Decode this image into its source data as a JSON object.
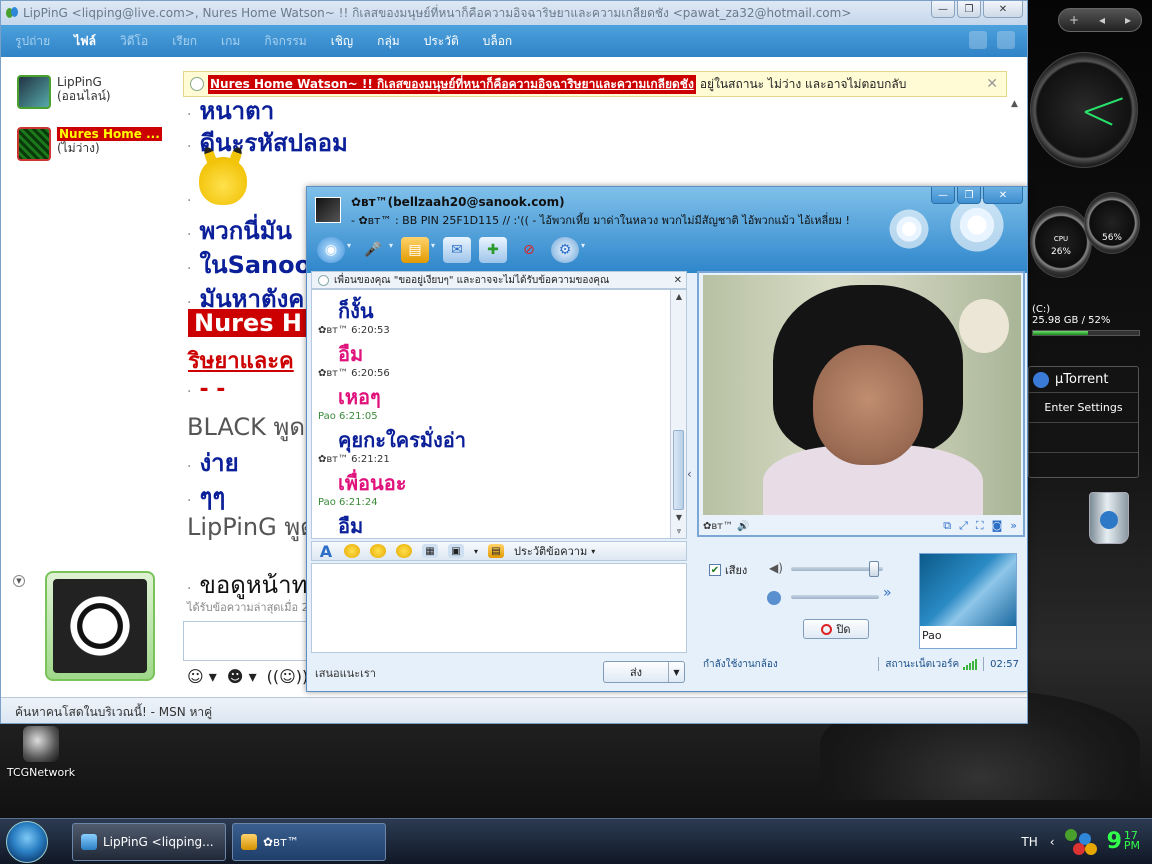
{
  "desktop": {
    "icon_label": "TCGNetwork",
    "gadgets": {
      "cpu_value": "26%",
      "cpu_label": "CPU",
      "mem_value": "56%",
      "drive_label": "(C:)",
      "drive_usage": "25.98 GB / 52%",
      "drive_used_fraction": 0.52,
      "torrent_title": "µTorrent",
      "torrent_settings": "Enter Settings"
    }
  },
  "main_window": {
    "title": "LipPinG <liqping@live.com>,  Nures Home Watson~ !! กิเลสของมนุษย์ที่หนาก็คือความอิจฉาริษยาและความเกลียดชัง  <pawat_za32@hotmail.com>",
    "menu": [
      "รูปถ่าย",
      "ไฟล์",
      "วิดีโอ",
      "เรียก",
      "เกม",
      "กิจกรรม",
      "เชิญ",
      "กลุ่ม",
      "ประวัติ",
      "บล็อก"
    ],
    "contacts": [
      {
        "name": "LipPinG",
        "status": "(ออนไลน์)"
      },
      {
        "name": "Nures Home ...",
        "status": "(ไม่ว่าง)"
      }
    ],
    "banner": {
      "highlight": "Nures Home Watson~ !! กิเลสของมนุษย์ที่หนาก็คือความอิจฉาริษยาและความเกลียดชัง",
      "text": "อยู่ในสถานะ ไม่ว่าง และอาจไม่ตอบกลับ"
    },
    "conversation": {
      "l1": "หนาตา",
      "l2": "ดีนะรหัสปลอม",
      "l3": "พวกนี่มัน",
      "l4": "ในSanoo",
      "l5": "มันหาตังค",
      "l6": "Nures H",
      "l7": "ริษยาและค",
      "l8": "- -",
      "l9": "BLACK พูด",
      "l10": "ง่าย",
      "l11": "ๆๆ",
      "l12": "LipPinG พูด",
      "l13": "ขอดูหน้าท"
    },
    "last_received": "ได้รับข้อความล่าสุดเมื่อ 2",
    "status_bar": "ค้นหาคนโสดในบริเวณนี้! - MSN หาคู่"
  },
  "conv_window": {
    "contact_name": "✿ʙᴛ™(bellzaah20@sanook.com)",
    "psm": "- ✿ʙᴛ™ : BB PIN 25F1D115 // :'(( - ไอ้พวกเหี้ย มาด่าในหลวง พวกไม่มีสัญชาติ ไอ้พวกแม้ว ไอ้เหลี่ยม !",
    "notice": "เพื่อนของคุณ \"ขออยู่เงียบๆ\" และอาจจะไม่ได้รับข้อความของคุณ",
    "messages": [
      {
        "head": "",
        "text": "ก็งั้น",
        "style": "blue"
      },
      {
        "head": "✿ʙᴛ™ 6:20:53",
        "text": "อืม",
        "style": "pink"
      },
      {
        "head": "✿ʙᴛ™ 6:20:56",
        "text": "เหอๆ",
        "style": "pink"
      },
      {
        "head": "Pao 6:21:05",
        "text": "คุยกะใครมั่งอ่า",
        "style": "blue"
      },
      {
        "head": "✿ʙᴛ™ 6:21:21",
        "text": "เพื่อนอะ",
        "style": "pink"
      },
      {
        "head": "Pao 6:21:24",
        "text": "อืม",
        "style": "blue"
      }
    ],
    "history_label": "ประวัติข้อความ",
    "suggest": "เสนอแนะเรา",
    "send_label": "ส่ง",
    "cam_name": "✿ʙᴛ™",
    "sound_label": "เสียง",
    "stop_label": "ปิด",
    "self_cam_name": "Pao",
    "cam_status": "กำลังใช้งานกล้อง",
    "network_status": "สถานะเน็ตเวอร์ค",
    "elapsed": "02:57"
  },
  "taskbar": {
    "task1": "LipPinG <liqping...",
    "task2": "✿ʙᴛ™",
    "lang": "TH",
    "time_hour": "9",
    "time_min": "17",
    "time_ampm": "PM"
  }
}
